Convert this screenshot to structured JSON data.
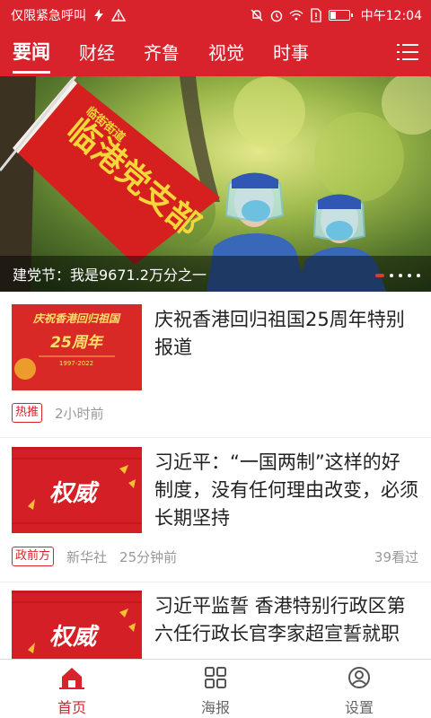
{
  "status_bar": {
    "left_text": "仅限紧急呼叫",
    "time": "中午12:04",
    "icons": [
      "flash-icon",
      "warning-icon",
      "mute-icon",
      "alarm-icon",
      "wifi-icon",
      "sim-icon",
      "battery-icon"
    ]
  },
  "nav": {
    "tabs": [
      {
        "label": "要闻",
        "active": true
      },
      {
        "label": "财经",
        "active": false
      },
      {
        "label": "齐鲁",
        "active": false
      },
      {
        "label": "视觉",
        "active": false
      },
      {
        "label": "时事",
        "active": false
      }
    ],
    "menu_icon": "menu-list-icon"
  },
  "hero": {
    "caption": "建党节：我是9671.2万分之一",
    "flag_text": "临港党支部",
    "flag_sub": "临街街道",
    "slide_count": 5,
    "active_slide": 1
  },
  "news": [
    {
      "title": "庆祝香港回归祖国25周年特别报道",
      "thumb_title": "庆祝香港回归祖国",
      "thumb_sub": "25周年",
      "thumb_years": "1997-2022",
      "tag": "热推",
      "source": "",
      "time": "2小时前",
      "views": ""
    },
    {
      "title": "习近平：“一国两制”这样的好制度，没有任何理由改变，必须长期坚持",
      "thumb_title": "权威",
      "tag": "政前方",
      "source": "新华社",
      "time": "25分钟前",
      "views": "39看过"
    },
    {
      "title": "习近平监誓 香港特别行政区第六任行政长官李家超宣誓就职",
      "thumb_title": "权威",
      "tag": "",
      "source": "",
      "time": "",
      "views": ""
    }
  ],
  "bottom_nav": [
    {
      "label": "首页",
      "icon": "home-icon",
      "active": true
    },
    {
      "label": "海报",
      "icon": "grid-icon",
      "active": false
    },
    {
      "label": "设置",
      "icon": "user-settings-icon",
      "active": false
    }
  ],
  "colors": {
    "brand_red": "#d9232c",
    "text": "#222222",
    "meta": "#999999"
  }
}
